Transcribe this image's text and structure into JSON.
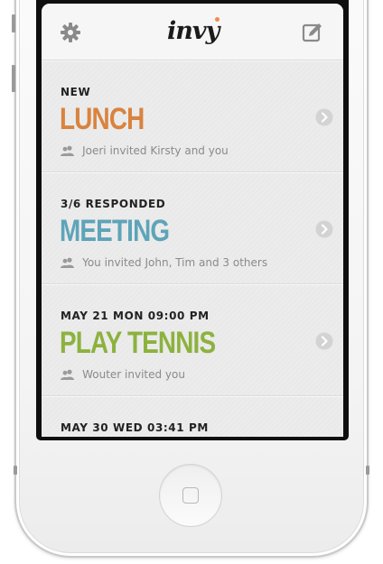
{
  "app": {
    "logo_text": "invy",
    "accent_color": "#f08a4b"
  },
  "header": {
    "settings_icon": "gear-icon",
    "compose_icon": "compose-icon"
  },
  "events": [
    {
      "status": "NEW",
      "title": "LUNCH",
      "color": "#d9833f",
      "meta": "Joeri invited Kirsty and you"
    },
    {
      "status": "3/6 RESPONDED",
      "title": "MEETING",
      "color": "#5ea4b9",
      "meta": "You invited John, Tim and 3 others"
    },
    {
      "status": "MAY 21 MON 09:00 PM",
      "title": "PLAY TENNIS",
      "color": "#8cb23e",
      "meta": "Wouter invited you"
    },
    {
      "status": "MAY 30 WED 03:41 PM",
      "title": "",
      "color": "#555555",
      "meta": ""
    }
  ]
}
